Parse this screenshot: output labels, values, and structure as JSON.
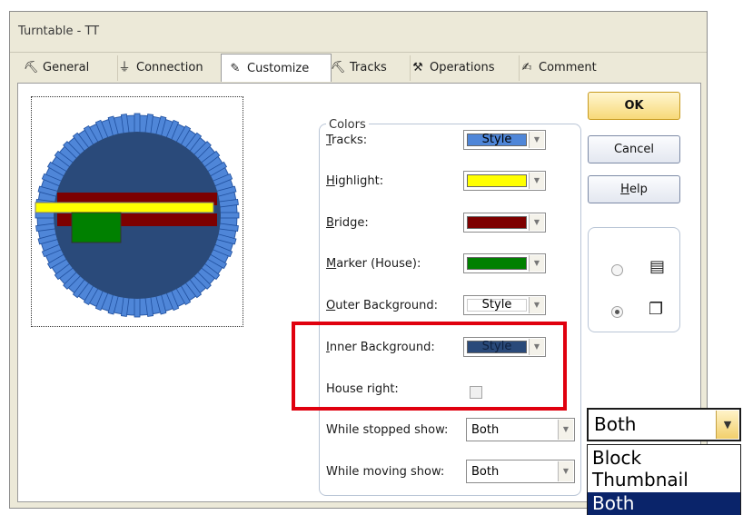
{
  "window": {
    "title": "Turntable - TT"
  },
  "tabs": [
    {
      "label": "General",
      "icon": "general-icon"
    },
    {
      "label": "Connection",
      "icon": "connection-plug-icon"
    },
    {
      "label": "Customize",
      "icon": "customize-icon",
      "active": true
    },
    {
      "label": "Tracks",
      "icon": "tracks-icon"
    },
    {
      "label": "Operations",
      "icon": "operations-icon"
    },
    {
      "label": "Comment",
      "icon": "comment-icon"
    }
  ],
  "colors_group": {
    "title": "Colors",
    "tracks": {
      "pre": "",
      "ul": "T",
      "post": "racks:",
      "value": "Style",
      "color": "#4f86d8"
    },
    "highlight": {
      "pre": "",
      "ul": "H",
      "post": "ighlight:",
      "color": "#ffff00"
    },
    "bridge": {
      "pre": "",
      "ul": "B",
      "post": "ridge:",
      "color": "#7d0000"
    },
    "marker": {
      "pre": "",
      "ul": "M",
      "post": "arker (House):",
      "color": "#008000"
    },
    "outer_background": {
      "pre": "",
      "ul": "O",
      "post": "uter Background:",
      "value": "Style",
      "color": "#ffffff"
    },
    "inner_background": {
      "pre": "",
      "ul": "I",
      "post": "nner Background:",
      "value": "Style",
      "color": "#2a4a7a"
    },
    "house_right": {
      "label": "House right:",
      "checked": false
    },
    "while_stopped": {
      "label": "While stopped show:",
      "value": "Both"
    },
    "while_moving": {
      "label": "While moving show:",
      "value": "Both"
    }
  },
  "buttons": {
    "ok": "OK",
    "cancel": "Cancel",
    "help_ul": "H",
    "help_rest": "elp"
  },
  "view_options": {
    "selected": "icons",
    "list_icon": "list-view-icon",
    "icons_icon": "icons-view-icon"
  },
  "popup": {
    "value": "Both",
    "options": [
      "Block",
      "Thumbnail",
      "Both"
    ],
    "selected": "Both"
  },
  "highlight_color": "#e0000e"
}
